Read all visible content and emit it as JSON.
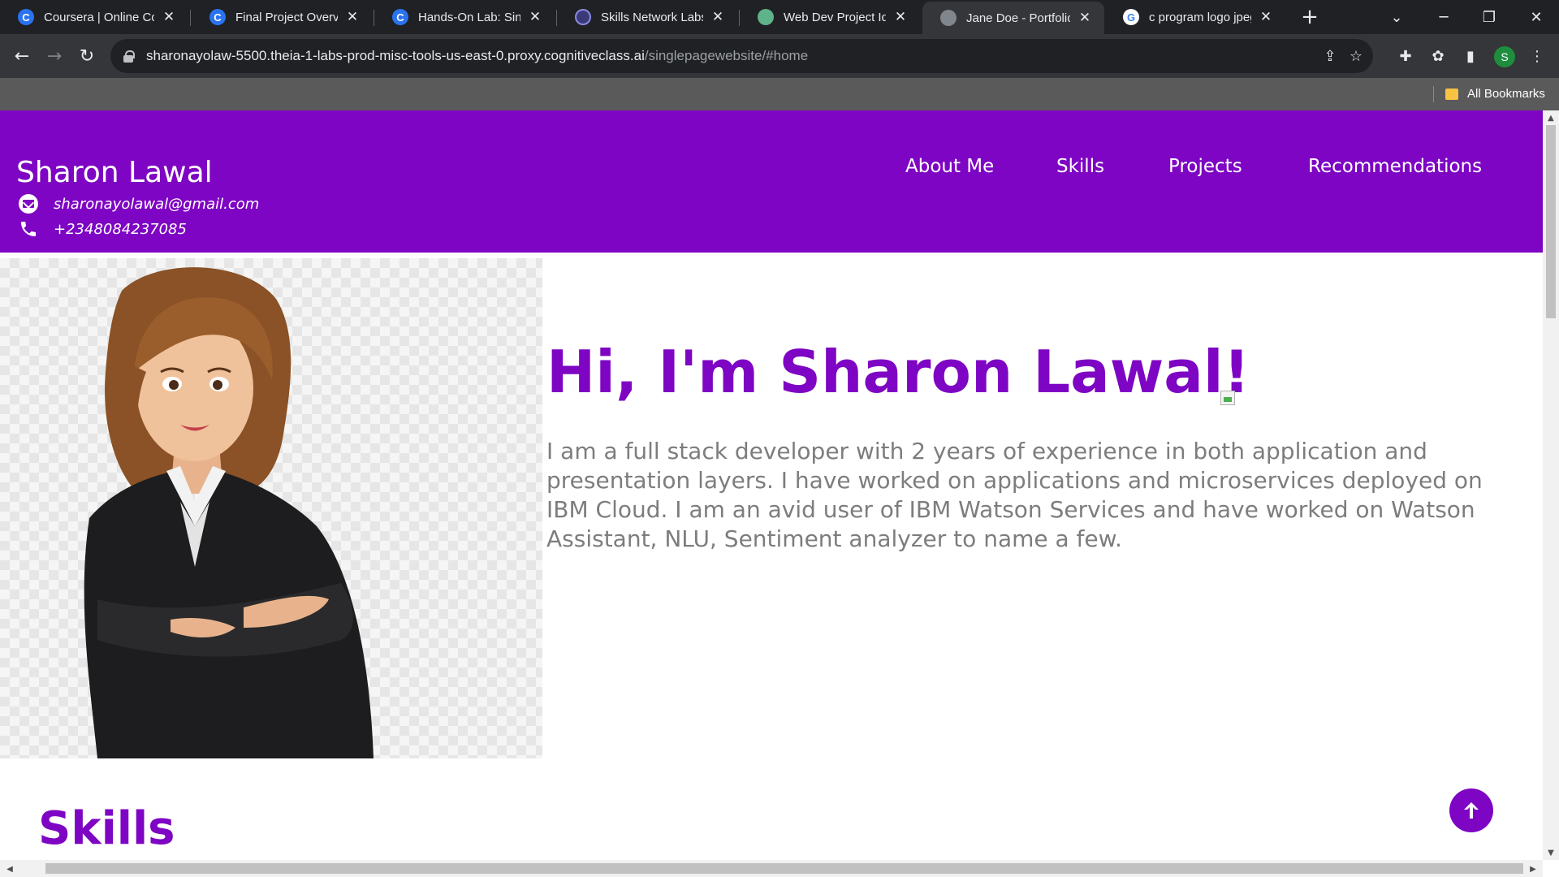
{
  "browser": {
    "tabs": [
      {
        "label": "Coursera | Online Courses",
        "icon": "coursera-icon",
        "active": false
      },
      {
        "label": "Final Project Overview",
        "icon": "coursera-icon",
        "active": false
      },
      {
        "label": "Hands-On Lab: Single",
        "icon": "coursera-icon",
        "active": false
      },
      {
        "label": "Skills Network Labs",
        "icon": "skills-network-icon",
        "active": false
      },
      {
        "label": "Web Dev Project Ideas",
        "icon": "chatgpt-icon",
        "active": false
      },
      {
        "label": "Jane Doe - Portfolio",
        "icon": "globe-icon",
        "active": true
      },
      {
        "label": "c program logo jpeg",
        "icon": "google-icon",
        "active": false
      }
    ],
    "address": {
      "host": "sharonayolaw-5500.theia-1-labs-prod-misc-tools-us-east-0.proxy.cognitiveclass.ai",
      "path": "/singlepagewebsite/#home"
    },
    "profile_initial": "S",
    "bookmarks_label": "All Bookmarks"
  },
  "site": {
    "name": "Sharon Lawal",
    "email": "sharonayolawal@gmail.com",
    "phone": "+2348084237085",
    "nav": [
      "About Me",
      "Skills",
      "Projects",
      "Recommendations"
    ],
    "hero_title": "Hi, I'm Sharon Lawal!",
    "hero_description": "I am a full stack developer with 2 years of experience in both application and presentation layers. I have worked on applications and microservices deployed on IBM Cloud. I am an avid user of IBM Watson Services and have worked on Watson Assistant, NLU, Sentiment analyzer to name a few.",
    "skills_heading": "Skills"
  },
  "colors": {
    "brand_purple": "#7e05c3",
    "description_gray": "#7d7d7d",
    "browser_dark": "#202124"
  }
}
